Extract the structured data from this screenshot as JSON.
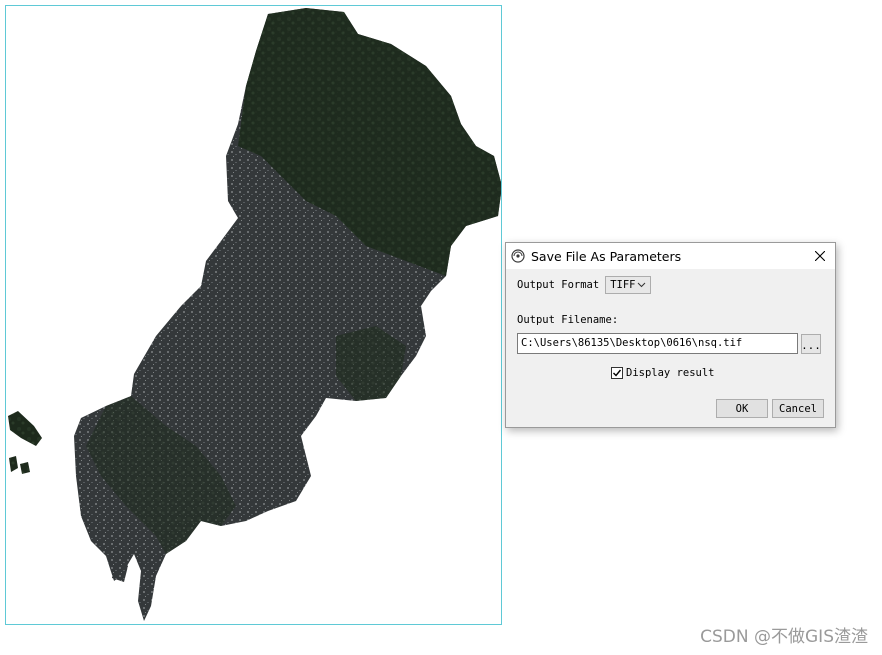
{
  "dialog": {
    "title": "Save File As Parameters",
    "close_icon": "close-icon",
    "app_icon": "envi-globe-icon",
    "output_format_label": "Output Format",
    "output_format_value": "TIFF",
    "output_filename_label": "Output Filename:",
    "output_filename_value": "C:\\Users\\86135\\Desktop\\0616\\nsq.tif",
    "browse_label": "...",
    "display_result_label": "Display result",
    "display_result_checked": true,
    "ok_label": "OK",
    "cancel_label": "Cancel"
  },
  "watermark": "CSDN @不做GIS渣渣",
  "colors": {
    "frame_border": "#5fc9d6",
    "vegetation": "#1f2b1d",
    "urban": "#3a3d3f"
  }
}
